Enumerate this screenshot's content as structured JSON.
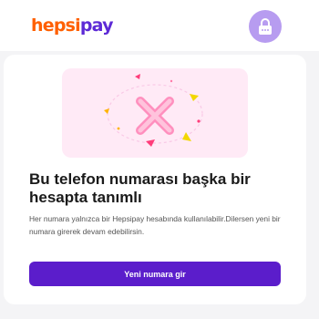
{
  "header": {
    "logo_part1": "hepsi",
    "logo_part2": "pay",
    "lock_icon": "lock-icon"
  },
  "card": {
    "illustration_icon": "error-x-icon",
    "title": "Bu telefon numarası başka bir hesapta tanımlı",
    "description": "Her numara yalnızca bir Hepsipay hesabında kullanılabilir.Dilersen yeni bir numara girerek devam edebilirsin.",
    "button_label": "Yeni numara gir"
  },
  "colors": {
    "brand_orange": "#ff6000",
    "brand_purple": "#5d2ad6",
    "button_purple": "#5b1dcb",
    "illustration_bg": "#ffeaf6"
  }
}
